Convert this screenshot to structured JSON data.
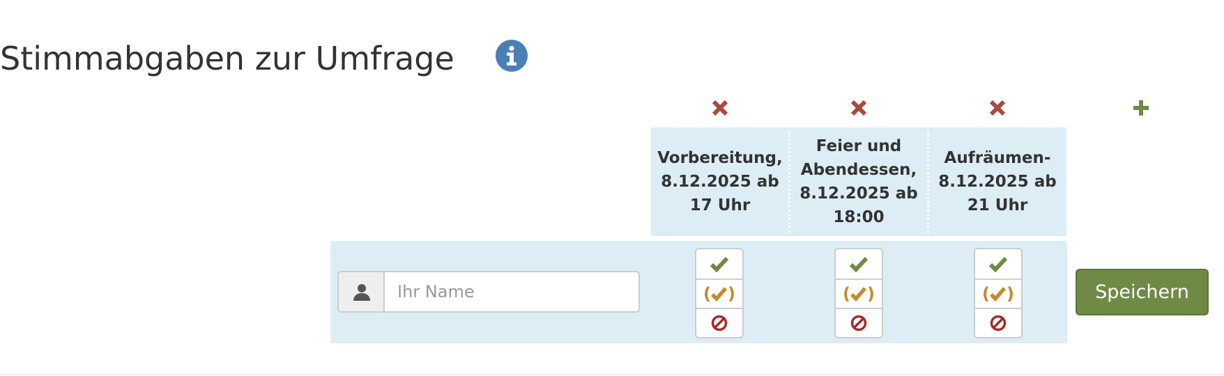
{
  "page": {
    "title": "Stimmabgaben zur Umfrage"
  },
  "icons": {
    "info": "info-icon",
    "remove_column": "remove-icon",
    "add_column": "plus-icon",
    "user": "user-icon",
    "yes": "check-icon",
    "maybe": "check-in-parentheses-icon",
    "no": "ban-icon"
  },
  "colors": {
    "info": "#4a7fb5",
    "remove": "#a94a3f",
    "add": "#6f8a45",
    "yes": "#6f8a45",
    "maybe": "#c48a2c",
    "no": "#a52a2a",
    "highlight": "#ddedf5",
    "save_button": "#6f8a45"
  },
  "columns": [
    {
      "label": "Vorbereitung, 8.12.2025 ab 17 Uhr"
    },
    {
      "label": "Feier und Abendessen, 8.12.2025 ab 18:00"
    },
    {
      "label": "Aufräumen- 8.12.2025 ab 21 Uhr"
    }
  ],
  "vote_row": {
    "name_placeholder": "Ihr Name",
    "name_value": "",
    "choices": {
      "maybe_open": "(",
      "maybe_close": ")"
    },
    "save_label": "Speichern"
  }
}
